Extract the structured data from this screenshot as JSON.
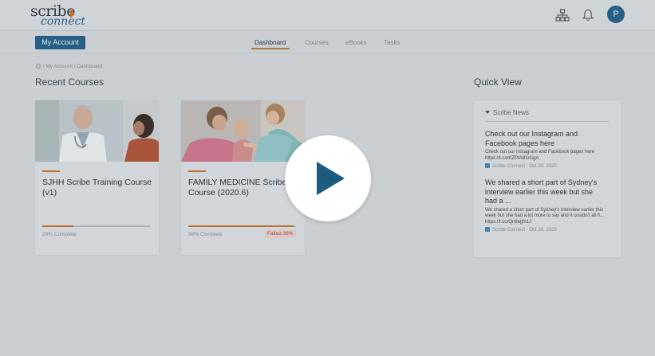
{
  "app": {
    "logo_top": "scribe",
    "logo_bottom": "connect"
  },
  "header": {
    "avatar_initial": "P",
    "icons": [
      "sitemap-icon",
      "bell-icon"
    ]
  },
  "subnav": {
    "account_button": "My Account",
    "tabs": [
      {
        "label": "Dashboard",
        "active": true
      },
      {
        "label": "Courses",
        "active": false
      },
      {
        "label": "eBooks",
        "active": false
      },
      {
        "label": "Tasks",
        "active": false
      }
    ]
  },
  "breadcrumb": {
    "items": [
      "My Account",
      "Dashboard"
    ],
    "separator": "/"
  },
  "recent_courses": {
    "title": "Recent Courses",
    "courses": [
      {
        "title": "SJHH Scribe Training Course (v1)",
        "progress_percent": 29,
        "progress_text": "29% Complete",
        "badge": ""
      },
      {
        "title": "FAMILY MEDICINE Scribe Course (2020.6)",
        "progress_percent": 98,
        "progress_text": "98% Complete",
        "badge": "Failed 38%"
      }
    ]
  },
  "quick_view": {
    "title": "Quick View",
    "section": "Scribe News",
    "news": [
      {
        "title": "Check out our Instagram and Facebook pages here",
        "body": "Check out our Instagram and Facebook pages here https://t.co/KZPtABGGgA",
        "source": "Scribe Connect",
        "date": "Oct 30, 2020"
      },
      {
        "title": "We shared a short part of Sydney's interview earlier this week but she had a ...",
        "body": "We shared a short part of Sydney's interview earlier this week but she had a lot more to say and it couldn't all fi... https://t.co/Qn8ejjfn1J",
        "source": "Scribe Connect",
        "date": "Oct 30, 2020"
      }
    ]
  },
  "colors": {
    "primary": "#285f86",
    "accent": "#bf6f36",
    "failed": "#a24d49",
    "overlay": "#c9cfd3"
  },
  "video_overlay": {
    "icon": "play-icon"
  }
}
